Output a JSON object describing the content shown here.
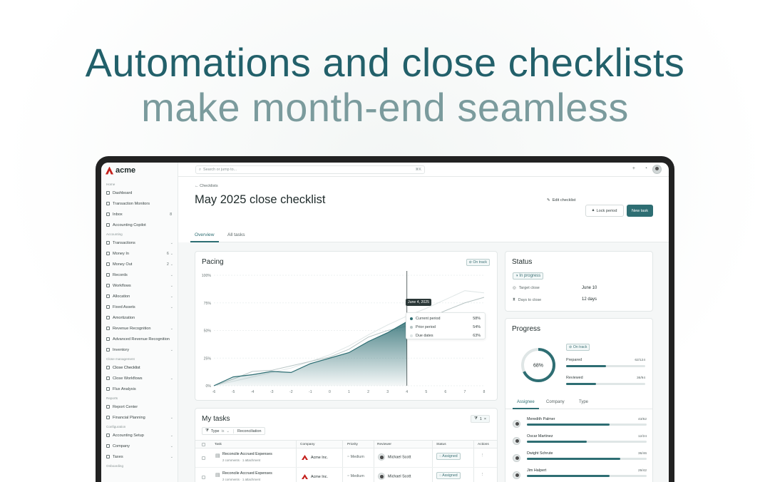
{
  "hero": {
    "title": "Automations and close checklists",
    "subtitle": "make month-end seamless"
  },
  "app": {
    "brand": "acme",
    "search_placeholder": "Search or jump to...",
    "search_shortcut": "⌘K"
  },
  "sidebar": [
    {
      "type": "section",
      "label": "Home"
    },
    {
      "type": "item",
      "label": "Dashboard",
      "icon": "home-icon"
    },
    {
      "type": "item",
      "label": "Transaction Monitors",
      "icon": "monitor-icon"
    },
    {
      "type": "item",
      "label": "Inbox",
      "icon": "inbox-icon",
      "count": "8"
    },
    {
      "type": "item",
      "label": "Accounting Copilot",
      "icon": "sparkle-icon"
    },
    {
      "type": "section",
      "label": "Accounting"
    },
    {
      "type": "item",
      "label": "Transactions",
      "icon": "transfer-icon",
      "chevron": true
    },
    {
      "type": "item",
      "label": "Money In",
      "icon": "money-in-icon",
      "count": "6",
      "chevron": true
    },
    {
      "type": "item",
      "label": "Money Out",
      "icon": "money-out-icon",
      "count": "2",
      "chevron": true
    },
    {
      "type": "item",
      "label": "Records",
      "icon": "records-icon",
      "chevron": true
    },
    {
      "type": "item",
      "label": "Workflows",
      "icon": "workflow-icon",
      "chevron": true
    },
    {
      "type": "item",
      "label": "Allocation",
      "icon": "allocation-icon",
      "chevron": true
    },
    {
      "type": "item",
      "label": "Fixed Assets",
      "icon": "asset-icon",
      "chevron": true
    },
    {
      "type": "item",
      "label": "Amortization",
      "icon": "hourglass-icon"
    },
    {
      "type": "item",
      "label": "Revenue Recognition",
      "icon": "revenue-icon",
      "chevron": true
    },
    {
      "type": "item",
      "label": "Advanced Revenue Recognition",
      "icon": "revenue-advanced-icon"
    },
    {
      "type": "item",
      "label": "Inventory",
      "icon": "inventory-icon",
      "chevron": true
    },
    {
      "type": "section",
      "label": "Close management"
    },
    {
      "type": "item",
      "label": "Close Checklist",
      "icon": "checklist-icon"
    },
    {
      "type": "item",
      "label": "Close Workflows",
      "icon": "workflow-icon",
      "chevron": true
    },
    {
      "type": "item",
      "label": "Flux Analysis",
      "icon": "chart-icon"
    },
    {
      "type": "section",
      "label": "Reports"
    },
    {
      "type": "item",
      "label": "Report Center",
      "icon": "report-icon"
    },
    {
      "type": "item",
      "label": "Financial Planning",
      "icon": "planning-icon",
      "chevron": true
    },
    {
      "type": "section",
      "label": "Configuration"
    },
    {
      "type": "item",
      "label": "Accounting Setup",
      "icon": "setup-icon",
      "chevron": true
    },
    {
      "type": "item",
      "label": "Company",
      "icon": "company-icon",
      "chevron": true
    },
    {
      "type": "item",
      "label": "Taxes",
      "icon": "tax-icon",
      "chevron": true
    },
    {
      "type": "section",
      "label": "Onboarding"
    }
  ],
  "page": {
    "breadcrumb": "← Checklists",
    "title": "May 2025 close checklist",
    "edit_label": "Edit checklist",
    "lock_label": "Lock period",
    "new_task_label": "New task",
    "tabs": [
      "Overview",
      "All tasks"
    ]
  },
  "pacing": {
    "title": "Pacing",
    "badge": "On track",
    "tooltip": {
      "date": "June 4, 2025",
      "rows": [
        {
          "label": "Current period",
          "value": "58%",
          "color": "#2e6e73"
        },
        {
          "label": "Prior period",
          "value": "54%",
          "color": "#b7c4c4"
        },
        {
          "label": "Due dates",
          "value": "63%",
          "color": "#dfe6e6"
        }
      ]
    }
  },
  "chart_data": {
    "type": "area",
    "x": [
      -6,
      -5,
      -4,
      -3,
      -2,
      -1,
      0,
      1,
      2,
      3,
      4,
      5,
      6,
      7,
      8
    ],
    "x_ticks": [
      "-6",
      "-5",
      "-4",
      "-3",
      "-2",
      "-1",
      "0",
      "1",
      "2",
      "3",
      "4",
      "5",
      "6",
      "7",
      "8"
    ],
    "y_ticks": [
      "0%",
      "25%",
      "50%",
      "75%",
      "100%"
    ],
    "ylim": [
      0,
      100
    ],
    "series": [
      {
        "values": [
          0,
          8,
          10,
          13,
          12,
          20,
          25,
          30,
          40,
          48,
          58
        ]
      },
      {
        "values": [
          0,
          6,
          13,
          14,
          18,
          22,
          26,
          33,
          44,
          50,
          54,
          60,
          68,
          75,
          80
        ]
      },
      {
        "values": [
          0,
          4,
          8,
          12,
          16,
          22,
          28,
          36,
          46,
          55,
          63,
          70,
          78,
          86,
          84
        ]
      }
    ],
    "marker_x": 4
  },
  "status": {
    "title": "Status",
    "state": "In progress",
    "rows": [
      {
        "label": "Target close",
        "value": "June 10",
        "icon": "target-icon"
      },
      {
        "label": "Days to close",
        "value": "12 days",
        "icon": "hourglass-icon"
      }
    ]
  },
  "progress": {
    "title": "Progress",
    "percent_label": "68%",
    "percent": 0.68,
    "badge": "On track",
    "bars": [
      {
        "label": "Prepared",
        "count": "62/124",
        "fraction": 0.5
      },
      {
        "label": "Reviewed",
        "count": "36/94",
        "fraction": 0.38
      }
    ],
    "tabs": [
      "Assignee",
      "Company",
      "Type"
    ],
    "assignees": [
      {
        "name": "Meredith Palmer",
        "count": "43/62",
        "fraction": 0.69
      },
      {
        "name": "Oscar Martinez",
        "count": "12/24",
        "fraction": 0.5
      },
      {
        "name": "Dwight Schrute",
        "count": "36/46",
        "fraction": 0.78
      },
      {
        "name": "Jim Halpert",
        "count": "29/42",
        "fraction": 0.69
      }
    ]
  },
  "tasks": {
    "title": "My tasks",
    "filter_count": "1",
    "filter": {
      "field": "Type",
      "op": "is",
      "value": "Reconciliation"
    },
    "columns": [
      "Task",
      "Company",
      "Priority",
      "Reviewer",
      "Status",
      "Actions"
    ],
    "rows": [
      {
        "task": "Reconcile Accrued Expenses",
        "meta": "2 comments · 1 attachment",
        "company": "Acme Inc.",
        "priority": "Medium",
        "reviewer": "Michael Scott",
        "status": "Assigned"
      },
      {
        "task": "Reconcile Accrued Expenses",
        "meta": "2 comments · 1 attachment",
        "company": "Acme Inc.",
        "priority": "Medium",
        "reviewer": "Michael Scott",
        "status": "Assigned"
      }
    ]
  }
}
